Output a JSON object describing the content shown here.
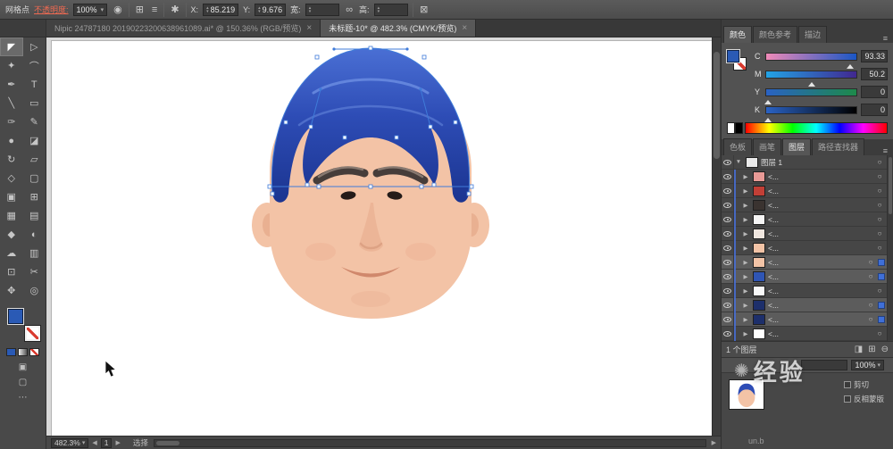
{
  "control_bar": {
    "context_label": "网格点",
    "opacity_label": "不透明度:",
    "opacity_value": "100%",
    "x_label": "X:",
    "x_value": "85.219",
    "y_label": "Y:",
    "y_value": "9.676",
    "w_label": "宽:",
    "w_value": "",
    "h_label": "高:",
    "h_value": ""
  },
  "icons": {
    "recolor": "◉",
    "align_grid": "⊞",
    "hamburger": "≡",
    "asterisk": "✱",
    "link": "∞",
    "free_transform": "⊠",
    "dropdown": "▾",
    "up": "▴",
    "down": "▾",
    "target": "○",
    "panel_menu": "≡",
    "prev": "◀",
    "next": "▶"
  },
  "doc_tabs": [
    {
      "name": "document-tab-nipic",
      "title": "Nipic 24787180 20190223200638961089.ai* @ 150.36% (RGB/预览)",
      "close": "×",
      "active": false
    },
    {
      "name": "document-tab-untitled",
      "title": "未标题-10* @ 482.3% (CMYK/预览)",
      "close": "×",
      "active": true
    }
  ],
  "toolbar": {
    "tools": [
      {
        "name": "selection-tool",
        "glyph": "◤",
        "active": true
      },
      {
        "name": "direct-selection-tool",
        "glyph": "▷"
      },
      {
        "name": "magic-wand-tool",
        "glyph": "✦"
      },
      {
        "name": "lasso-tool",
        "glyph": "⌒"
      },
      {
        "name": "pen-tool",
        "glyph": "✒"
      },
      {
        "name": "type-tool",
        "glyph": "T"
      },
      {
        "name": "line-segment-tool",
        "glyph": "╲"
      },
      {
        "name": "rectangle-tool",
        "glyph": "▭"
      },
      {
        "name": "paintbrush-tool",
        "glyph": "✑"
      },
      {
        "name": "pencil-tool",
        "glyph": "✎"
      },
      {
        "name": "blob-brush-tool",
        "glyph": "●"
      },
      {
        "name": "eraser-tool",
        "glyph": "◪"
      },
      {
        "name": "rotate-tool",
        "glyph": "↻"
      },
      {
        "name": "scale-tool",
        "glyph": "▱"
      },
      {
        "name": "width-tool",
        "glyph": "◇"
      },
      {
        "name": "free-transform-tool",
        "glyph": "▢"
      },
      {
        "name": "shape-builder-tool",
        "glyph": "▣"
      },
      {
        "name": "perspective-grid-tool",
        "glyph": "⊞"
      },
      {
        "name": "mesh-tool",
        "glyph": "▦"
      },
      {
        "name": "gradient-tool",
        "glyph": "▤"
      },
      {
        "name": "eyedropper-tool",
        "glyph": "◆"
      },
      {
        "name": "blend-tool",
        "glyph": "◐"
      },
      {
        "name": "symbol-sprayer-tool",
        "glyph": "☁"
      },
      {
        "name": "column-graph-tool",
        "glyph": "▥"
      },
      {
        "name": "artboard-tool",
        "glyph": "⊡"
      },
      {
        "name": "slice-tool",
        "glyph": "✂"
      },
      {
        "name": "hand-tool",
        "glyph": "✥"
      },
      {
        "name": "zoom-tool",
        "glyph": "◎"
      }
    ]
  },
  "color_panel": {
    "tabs": [
      {
        "name": "tab-color",
        "label": "颜色",
        "active": true
      },
      {
        "name": "tab-color-guide",
        "label": "颜色参考"
      },
      {
        "name": "tab-stroke",
        "label": "描边"
      }
    ],
    "channels": [
      {
        "label": "C",
        "value": "93.33",
        "pos": "93%",
        "grad": "linear-gradient(90deg,#ef8ab8,#1a56c4)"
      },
      {
        "label": "M",
        "value": "50.2",
        "pos": "50%",
        "grad": "linear-gradient(90deg,#22a3e6,#41278f)"
      },
      {
        "label": "Y",
        "value": "0",
        "pos": "2%",
        "grad": "linear-gradient(90deg,#2a62c4,#1d8a4a)"
      },
      {
        "label": "K",
        "value": "0",
        "pos": "2%",
        "grad": "linear-gradient(90deg,#2a62c4,#000000)"
      }
    ]
  },
  "panel_group2": {
    "tabs": [
      {
        "name": "tab-swatches",
        "label": "色板"
      },
      {
        "name": "tab-brushes",
        "label": "画笔"
      },
      {
        "name": "tab-layers",
        "label": "图层",
        "active": true
      },
      {
        "name": "tab-pathfinder",
        "label": "路径查找器"
      }
    ]
  },
  "layers": {
    "rows": [
      {
        "tri": "▼",
        "name": "图层 1",
        "thumb": "#e9e9e9",
        "sub": false,
        "sel": false
      },
      {
        "tri": "▶",
        "name": "<...",
        "thumb": "#e89a96",
        "sub": true,
        "sel": false
      },
      {
        "tri": "▶",
        "name": "<...",
        "thumb": "#c23f36",
        "sub": true,
        "sel": false
      },
      {
        "tri": "▶",
        "name": "<...",
        "thumb": "#3a3330",
        "sub": true,
        "sel": false
      },
      {
        "tri": "▶",
        "name": "<...",
        "thumb": "#f5f5f5",
        "sub": true,
        "sel": false
      },
      {
        "tri": "▶",
        "name": "<...",
        "thumb": "#efe6df",
        "sub": true,
        "sel": false
      },
      {
        "tri": "▶",
        "name": "<...",
        "thumb": "#f2c3a6",
        "sub": true,
        "sel": false
      },
      {
        "tri": "▶",
        "name": "<...",
        "thumb": "#f2c3a6",
        "sub": true,
        "sel": true
      },
      {
        "tri": "▶",
        "name": "<...",
        "thumb": "#2f55b4",
        "sub": true,
        "sel": true
      },
      {
        "tri": "▶",
        "name": "<...",
        "thumb": "#f8f8f8",
        "sub": true,
        "sel": false
      },
      {
        "tri": "▶",
        "name": "<...",
        "thumb": "#1d2f6b",
        "sub": true,
        "sel": true
      },
      {
        "tri": "▶",
        "name": "<...",
        "thumb": "#1d2f6b",
        "sub": true,
        "sel": true
      },
      {
        "tri": "▶",
        "name": "<...",
        "thumb": "#ffffff",
        "sub": true,
        "sel": false
      }
    ],
    "footer": "1 个图层",
    "footer_icons": [
      {
        "name": "clip-mask-button",
        "glyph": "◨"
      },
      {
        "name": "new-layer-button",
        "glyph": "⊞"
      },
      {
        "name": "delete-layer-button",
        "glyph": "⊖"
      }
    ]
  },
  "transparency": {
    "opacity_value": "100%",
    "clip_label": "剪切",
    "invert_label": "反相蒙版"
  },
  "status_bar": {
    "zoom": "482.3%",
    "artboard": "1",
    "status": "选择"
  },
  "watermark": {
    "symbol": "✺",
    "text": "经验",
    "url_fragment": "un.b"
  }
}
